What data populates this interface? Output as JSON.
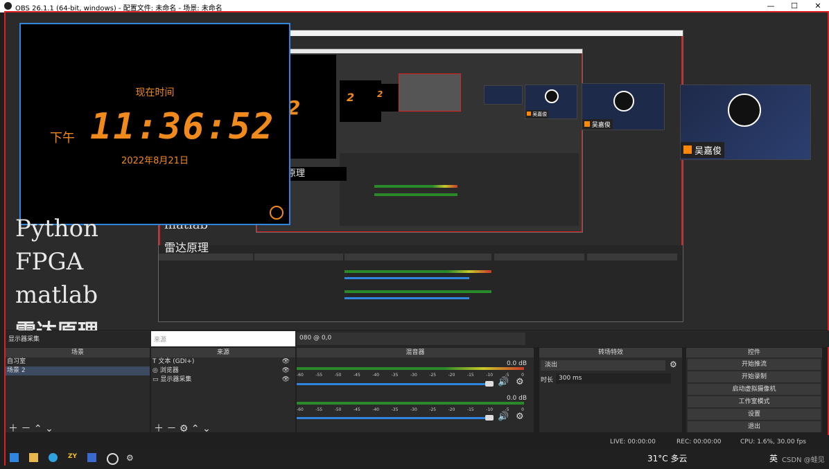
{
  "window": {
    "title": "OBS 26.1.1 (64-bit, windows) - 配置文件: 未命名 - 场景: 未命名",
    "controls": [
      "—",
      "☐",
      "✕"
    ]
  },
  "clock": {
    "label": "现在时间",
    "ampm": "下午",
    "time": "11:36:52",
    "date": "2022年8月21日"
  },
  "text_source": {
    "lines": [
      "Python",
      "FPGA",
      "matlab",
      "雷达原理"
    ]
  },
  "people": {
    "name": "吴嘉俊"
  },
  "nested": {
    "digit": "2",
    "matlab": "matlab",
    "radar": "雷达原理"
  },
  "dock": {
    "display_label": "显示器采集",
    "source_placeholder": "来源",
    "coords": "080 @ 0,0",
    "panels": {
      "scenes": "场景",
      "sources": "来源",
      "mixer": "混音器",
      "transitions": "转场特效",
      "controls": "控件"
    },
    "scenes": [
      "自习室",
      "场景 2"
    ],
    "sources": [
      "文本 (GDI+)",
      "浏览器",
      "显示器采集"
    ],
    "mixer": {
      "level1": "0.0 dB",
      "level2": "0.0 dB",
      "ticks": [
        "-60",
        "-55",
        "-50",
        "-45",
        "-40",
        "-35",
        "-30",
        "-25",
        "-20",
        "-15",
        "-10",
        "-5",
        "0"
      ]
    },
    "transition": {
      "value": "淡出",
      "duration_label": "时长",
      "duration_value": "300 ms"
    },
    "controls": [
      "开始推流",
      "开始录制",
      "启动虚拟摄像机",
      "工作室模式",
      "设置",
      "退出"
    ]
  },
  "status": {
    "live": "LIVE: 00:00:00",
    "rec": "REC: 00:00:00",
    "cpu": "CPU: 1.6%, 30.00 fps"
  },
  "taskbar": {
    "weather": "31°C 多云",
    "ime": "英",
    "clock_text": "CSDN @蛙见"
  },
  "colors": {
    "accent_orange": "#f08a1c",
    "selection_red": "#e02020",
    "focus_blue": "#2f86e0",
    "panel_bg": "#2a2a2a"
  }
}
